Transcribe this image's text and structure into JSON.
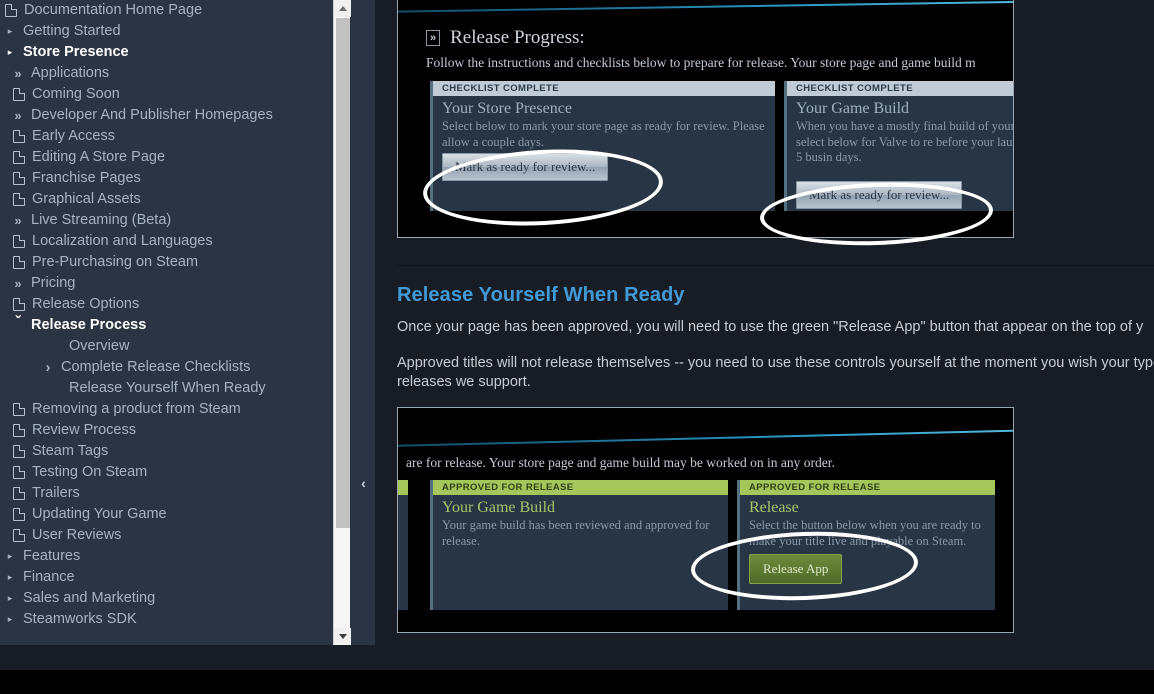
{
  "sidebar": {
    "items": [
      {
        "label": "Documentation Home Page",
        "icon": "document-icon",
        "level": 0,
        "bold": false
      },
      {
        "label": "Getting Started",
        "icon": "bullet-right-icon",
        "level": 0,
        "bold": false
      },
      {
        "label": "Store Presence",
        "icon": "bullet-right-icon",
        "level": 0,
        "bold": true
      },
      {
        "label": "Applications",
        "icon": "double-chevron-icon",
        "level": 1,
        "bold": false
      },
      {
        "label": "Coming Soon",
        "icon": "document-icon",
        "level": 1,
        "bold": false
      },
      {
        "label": "Developer And Publisher Homepages",
        "icon": "double-chevron-icon",
        "level": 1,
        "bold": false
      },
      {
        "label": "Early Access",
        "icon": "document-icon",
        "level": 1,
        "bold": false
      },
      {
        "label": "Editing A Store Page",
        "icon": "document-icon",
        "level": 1,
        "bold": false
      },
      {
        "label": "Franchise Pages",
        "icon": "document-icon",
        "level": 1,
        "bold": false
      },
      {
        "label": "Graphical Assets",
        "icon": "document-icon",
        "level": 1,
        "bold": false
      },
      {
        "label": "Live Streaming (Beta)",
        "icon": "double-chevron-icon",
        "level": 1,
        "bold": false
      },
      {
        "label": "Localization and Languages",
        "icon": "document-icon",
        "level": 1,
        "bold": false
      },
      {
        "label": "Pre-Purchasing on Steam",
        "icon": "document-icon",
        "level": 1,
        "bold": false
      },
      {
        "label": "Pricing",
        "icon": "double-chevron-icon",
        "level": 1,
        "bold": false
      },
      {
        "label": "Release Options",
        "icon": "document-icon",
        "level": 1,
        "bold": false
      },
      {
        "label": "Release Process",
        "icon": "chevron-down-icon",
        "level": 1,
        "bold": true
      },
      {
        "label": "Overview",
        "icon": "none",
        "level": 3,
        "bold": false
      },
      {
        "label": "Complete Release Checklists",
        "icon": "chevron-right-icon",
        "level": 2,
        "bold": false
      },
      {
        "label": "Release Yourself When Ready",
        "icon": "none",
        "level": 3,
        "bold": false
      },
      {
        "label": "Removing a product from Steam",
        "icon": "document-icon",
        "level": 1,
        "bold": false
      },
      {
        "label": "Review Process",
        "icon": "document-icon",
        "level": 1,
        "bold": false
      },
      {
        "label": "Steam Tags",
        "icon": "document-icon",
        "level": 1,
        "bold": false
      },
      {
        "label": "Testing On Steam",
        "icon": "document-icon",
        "level": 1,
        "bold": false
      },
      {
        "label": "Trailers",
        "icon": "document-icon",
        "level": 1,
        "bold": false
      },
      {
        "label": "Updating Your Game",
        "icon": "document-icon",
        "level": 1,
        "bold": false
      },
      {
        "label": "User Reviews",
        "icon": "document-icon",
        "level": 1,
        "bold": false
      },
      {
        "label": "Features",
        "icon": "bullet-right-icon",
        "level": 0,
        "bold": false
      },
      {
        "label": "Finance",
        "icon": "bullet-right-icon",
        "level": 0,
        "bold": false
      },
      {
        "label": "Sales and Marketing",
        "icon": "bullet-right-icon",
        "level": 0,
        "bold": false
      },
      {
        "label": "Steamworks SDK",
        "icon": "bullet-right-icon",
        "level": 0,
        "bold": false
      }
    ],
    "collapse_label": "‹"
  },
  "content": {
    "top_screenshot": {
      "header_badge": "»",
      "header_title": "Release Progress:",
      "subtitle": "Follow the instructions and checklists below to prepare for release. Your store page and game build m",
      "cards": [
        {
          "banner": "CHECKLIST COMPLETE",
          "title": "Your Store Presence",
          "body": "Select below to mark your store page as ready for review. Please allow a couple days.",
          "button": "Mark as ready for review..."
        },
        {
          "banner": "CHECKLIST COMPLETE",
          "title": "Your Game Build",
          "body": "When you have a mostly final build of your game uploaded, select below for Valve to re before your launch. Please allow for 5 busin days.",
          "button": "Mark as ready for review..."
        }
      ]
    },
    "section": {
      "title": "Release Yourself When Ready",
      "paragraph_1": "Once your page has been approved, you will need to use the green \"Release App\" button that appear on the top of y",
      "paragraph_2": "Approved titles will not release themselves -- you need to use these controls yourself at the moment you wish your types of releases we support."
    },
    "bottom_screenshot": {
      "subtitle": "are for release. Your store page and game build may be worked on in any order.",
      "cards": [
        {
          "banner": "APPROVED FOR RELEASE",
          "title": "Your Game Build",
          "body": "Your game build has been reviewed and approved for release.",
          "button": ""
        },
        {
          "banner": "APPROVED FOR RELEASE",
          "title": "Release",
          "body": "Select the button below when you are ready to make your title live and playable on Steam.",
          "button": "Release App"
        }
      ]
    }
  },
  "colors": {
    "sidebar_bg": "#2a3443",
    "page_bg": "#181d25",
    "accent_blue": "#419ad6",
    "green": "#a4c65a",
    "annotation": "#ffffff"
  }
}
